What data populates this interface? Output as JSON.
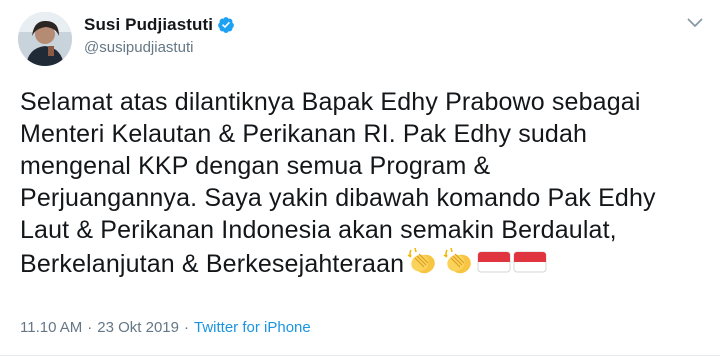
{
  "user": {
    "display_name": "Susi Pudjiastuti",
    "handle": "@susipudjiastuti",
    "verified": true
  },
  "icons": {
    "verified": "verified-badge-icon",
    "menu": "chevron-down-icon",
    "emoji_1": "clapping-hands-emoji",
    "emoji_2": "clapping-hands-emoji",
    "emoji_3": "indonesia-flag-emoji",
    "emoji_4": "indonesia-flag-emoji"
  },
  "tweet": {
    "lines": [
      "Selamat atas dilantiknya Bapak Edhy Prabowo sebagai",
      "Menteri Kelautan & Perikanan RI. Pak Edhy sudah",
      "mengenal KKP dengan semua Program &",
      "Perjuangannya. Saya yakin dibawah komando Pak Edhy",
      "Laut & Perikanan Indonesia akan semakin Berdaulat,",
      "Berkelanjutan & Berkesejahteraan"
    ]
  },
  "meta": {
    "time": "11.10 AM",
    "separator": "·",
    "date": "23 Okt 2019",
    "source": "Twitter for iPhone"
  },
  "colors": {
    "text": "#14171a",
    "secondary": "#657786",
    "link": "#1b95e0",
    "verified": "#1da1f2"
  }
}
